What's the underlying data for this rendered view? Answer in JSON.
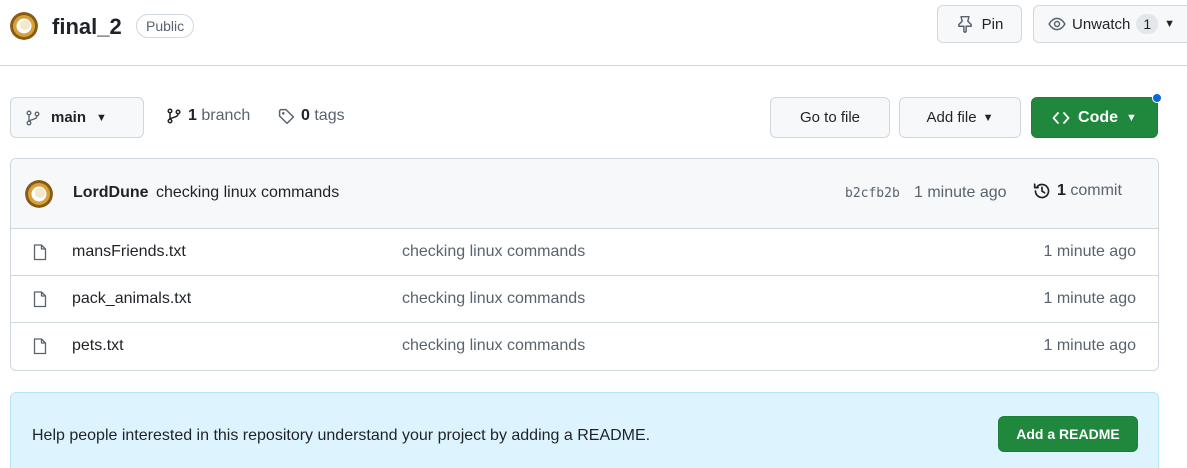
{
  "repo": {
    "name": "final_2",
    "visibility": "Public",
    "pin_label": "Pin",
    "watch_label": "Unwatch",
    "watch_count": "1"
  },
  "toolbar": {
    "branch_name": "main",
    "branch_count": "1",
    "branch_word": "branch",
    "tag_count": "0",
    "tag_word": "tags",
    "goto_label": "Go to file",
    "add_file_label": "Add file",
    "code_label": "Code"
  },
  "latest_commit": {
    "author": "LordDune",
    "message": "checking linux commands",
    "sha": "b2cfb2b",
    "time": "1 minute ago",
    "count": "1",
    "count_word": "commit"
  },
  "files": [
    {
      "name": "mansFriends.txt",
      "message": "checking linux commands",
      "time": "1 minute ago"
    },
    {
      "name": "pack_animals.txt",
      "message": "checking linux commands",
      "time": "1 minute ago"
    },
    {
      "name": "pets.txt",
      "message": "checking linux commands",
      "time": "1 minute ago"
    }
  ],
  "readme": {
    "text": "Help people interested in this repository understand your project by adding a README.",
    "button_label": "Add a README"
  },
  "colors": {
    "primary_green": "#1f883d",
    "banner_blue": "#ddf4ff",
    "notification_blue": "#0969da",
    "avatar_gold": "#b8862b"
  },
  "icons": {
    "pin": "pin-icon",
    "watch": "eye-icon",
    "branch": "git-branch-icon",
    "tag": "tag-icon",
    "code": "code-icon",
    "history": "history-icon",
    "file": "file-icon"
  }
}
